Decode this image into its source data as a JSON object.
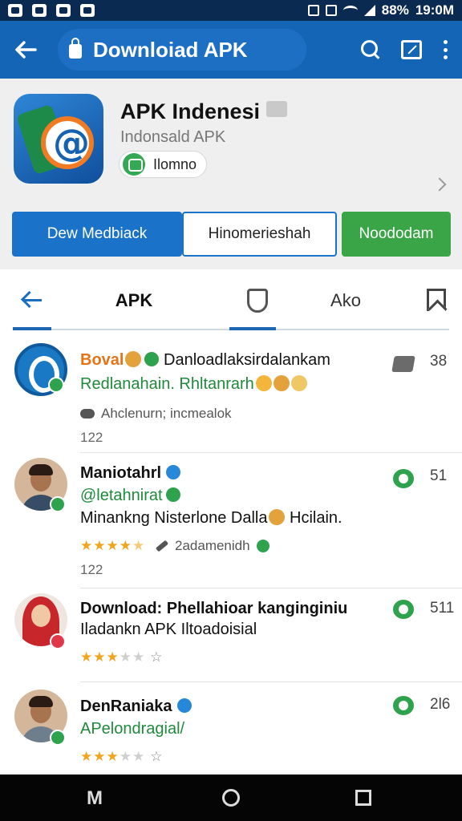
{
  "status_bar": {
    "battery": "88%",
    "time": "19:0M"
  },
  "app_bar": {
    "title": "Downloiad APK"
  },
  "app": {
    "name": "APK Indenesi",
    "developer": "Indonsald APK",
    "chip_label": "Ilomno"
  },
  "buttons": {
    "primary": "Dew Medbiack",
    "secondary": "Hinomerieshah",
    "download": "Noododam"
  },
  "tabs": {
    "apk": "APK",
    "ako": "Ako"
  },
  "feed": [
    {
      "name": "Boval",
      "text": "Danloadlaksirdalankam",
      "line2": "Redlanahain. Rhltanrarh",
      "meta": "Ahclenurn; incmealok",
      "count": "122",
      "right_count": "38",
      "right_icon": "thumb-icon"
    },
    {
      "name": "Maniotahrl",
      "line2": "@letahnirat",
      "line3": "Minankng Nisterlone Dalla",
      "line3_tail": "Hcilain.",
      "meta": "2adamenidh",
      "count": "122",
      "rating": 4.5,
      "right_count": "51",
      "right_icon": "chat-icon"
    },
    {
      "name": "Download: Phellahioar kanginginiu",
      "line3": "Iladankn APK Iltoadoisial",
      "rating": 3,
      "right_count": "511",
      "right_icon": "chat-icon"
    },
    {
      "name": "DenRaniaka",
      "line2": "APelondragial/",
      "rating": 3,
      "right_count": "2l6",
      "right_icon": "chat-icon"
    }
  ],
  "nav": {
    "menu_glyph": "M"
  },
  "colors": {
    "app_bar": "#1565b7",
    "status_bar": "#0b2a52",
    "accent_blue": "#1a73c9",
    "accent_green": "#3aa547",
    "star": "#f2a41c"
  }
}
